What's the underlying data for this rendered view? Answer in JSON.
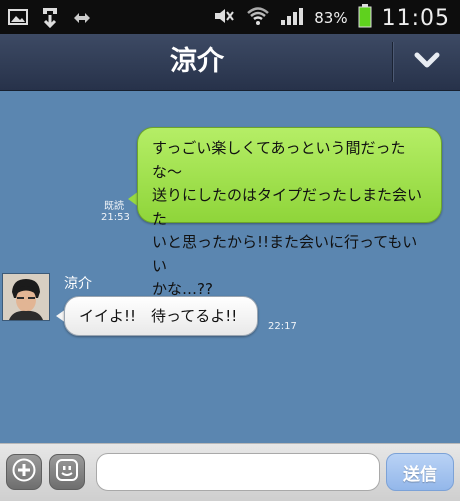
{
  "status_bar": {
    "battery_percent": "83%",
    "time": "11:05",
    "icons": [
      "gallery-icon",
      "download-icon",
      "sync-icon",
      "mute-icon",
      "wifi-icon",
      "signal-icon",
      "battery-icon"
    ]
  },
  "header": {
    "title": "涼介",
    "collapse_icon": "chevron-down-icon"
  },
  "messages": {
    "outgoing": {
      "lines": [
        "すっごい楽しくてあっという間だったな〜",
        "送りにしたのはタイプだったしまた会いた",
        "いと思ったから!!また会いに行ってもいい",
        "かな…??"
      ],
      "read_label": "既読",
      "time": "21:53"
    },
    "incoming": {
      "sender": "涼介",
      "text": "イイよ!!　待ってるよ!!",
      "time": "22:17"
    }
  },
  "composer": {
    "input_value": "",
    "send_label": "送信"
  },
  "colors": {
    "chat_background": "#5b86b0",
    "outgoing_bubble": "#a6e254",
    "header": "#2f3a52",
    "send_button": "#93b7ea"
  }
}
